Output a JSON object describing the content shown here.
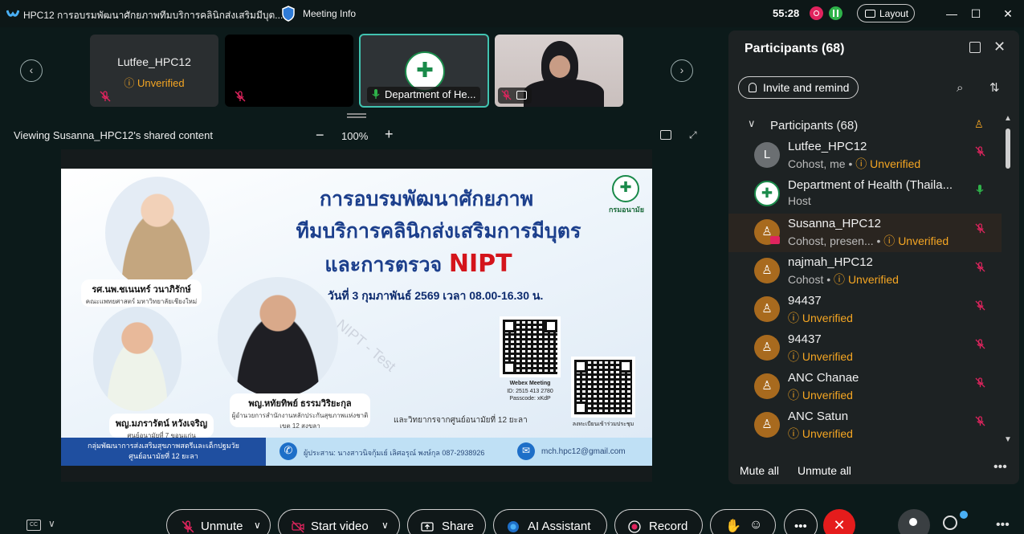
{
  "titlebar": {
    "app_title": "HPC12 การอบรมพัฒนาศักยภาพทีมบริการคลินิกส่งเสริมมีบุต...",
    "meeting_info": "Meeting Info",
    "timer": "55:28",
    "layout_label": "Layout"
  },
  "strip": {
    "tile1_name": "Lutfee_HPC12",
    "tile1_status": "Unverified",
    "tile3_name": "Department of He...",
    "nav_prev": "‹",
    "nav_next": "›"
  },
  "share_bar": {
    "viewing": "Viewing Susanna_HPC12's shared content",
    "zoom_out": "−",
    "zoom": "100%",
    "zoom_in": "+"
  },
  "shared_slide": {
    "title_line1": "การอบรมพัฒนาศักยภาพ",
    "title_line2": "ทีมบริการคลินิกส่งเสริมการมีบุตร",
    "title_line3_prefix": "และการตรวจ ",
    "title_line3_accent": "NIPT",
    "date_line": "วันที่ 3 กุมภาพันธ์ 2569 เวลา 08.00-16.30 น.",
    "logo_text": "กรมอนามัย",
    "speaker1_name": "รศ.นพ.ชเนนทร์ วนาภิรักษ์",
    "speaker1_affil": "คณะแพทยศาสตร์ มหาวิทยาลัยเชียงใหม่",
    "speaker2_name": "พญ.มภรารัตน์ หวังเจริญ",
    "speaker2_affil": "ศูนย์อนามัยที่ 7 ขอนแก่น",
    "speaker3_name": "พญ.หทัยทิพย์ ธรรมวิริยะกุล",
    "speaker3_affil1": "ผู้อำนวยการสำนักงานหลักประกันสุขภาพแห่งชาติ",
    "speaker3_affil2": "เขต 12 สงขลา",
    "lecture_note": "และวิทยากรจากศูนย์อนามัยที่ 12 ยะลา",
    "qr1_title": "Webex Meeting",
    "qr1_id": "ID: 2515 413 2780",
    "qr1_pass": "Passcode: xKdP",
    "qr2_caption": "ลงทะเบียนเข้าร่วมประชุม",
    "footer_org_line1": "กลุ่มพัฒนาการส่งเสริมสุขภาพสตรีและเด็กปฐมวัย",
    "footer_org_line2": "ศูนย์อนามัยที่ 12 ยะลา",
    "footer_contact": "ผู้ประสาน: นางสาวนิจกุ้มเย์ เลิศอรุณ์ พงษ์กุล 087-2938926",
    "footer_email": "mch.hpc12@gmail.com",
    "watermark": "NIPT - Test"
  },
  "panel": {
    "title": "Participants (68)",
    "invite_label": "Invite and remind",
    "section_label": "Participants (68)",
    "participants": [
      {
        "name": "Lutfee_HPC12",
        "role": "Cohost, me • ",
        "status": "Unverified",
        "avatar": "L"
      },
      {
        "name": "Department of Health (Thaila...",
        "role": "Host",
        "status": "",
        "avatar": ""
      },
      {
        "name": "Susanna_HPC12",
        "role": "Cohost, presen...  • ",
        "status": "Unverified",
        "avatar": ""
      },
      {
        "name": "najmah_HPC12",
        "role": "Cohost • ",
        "status": "Unverified",
        "avatar": ""
      },
      {
        "name": "94437",
        "role": "",
        "status": "Unverified",
        "avatar": ""
      },
      {
        "name": "94437",
        "role": "",
        "status": "Unverified",
        "avatar": ""
      },
      {
        "name": "ANC Chanae",
        "role": "",
        "status": "Unverified",
        "avatar": ""
      },
      {
        "name": "ANC Satun",
        "role": "",
        "status": "Unverified",
        "avatar": ""
      }
    ],
    "mute_all": "Mute all",
    "unmute_all": "Unmute all"
  },
  "toolbar": {
    "unmute": "Unmute",
    "start_video": "Start video",
    "share": "Share",
    "ai_assistant": "AI Assistant",
    "record": "Record",
    "cc": "CC"
  },
  "colors": {
    "unverified": "#f5a623",
    "accent_teal": "#41c3b0",
    "end_red": "#e51c1c"
  }
}
